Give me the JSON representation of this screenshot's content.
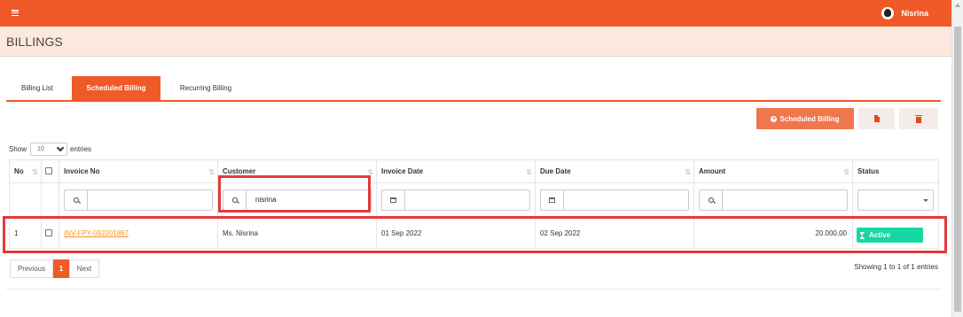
{
  "header": {
    "user_name": "Nisrina"
  },
  "page": {
    "title": "BILLINGS"
  },
  "tabs": [
    {
      "label": "Billing List",
      "active": false
    },
    {
      "label": "Scheduled Billing",
      "active": true
    },
    {
      "label": "Recurring Billing",
      "active": false
    }
  ],
  "toolbar": {
    "add_label": "Scheduled Billing",
    "pdf_icon": "file-pdf-icon",
    "delete_icon": "trash-icon"
  },
  "entries": {
    "show_label": "Show",
    "value": "10",
    "suffix": "entries"
  },
  "table": {
    "columns": [
      "No",
      "Invoice No",
      "Customer",
      "Invoice Date",
      "Due Date",
      "Amount",
      "Status"
    ],
    "filters": {
      "invoice_no": "",
      "customer": "nisrina",
      "invoice_date": "",
      "due_date": "",
      "amount": "",
      "status": ""
    },
    "rows": [
      {
        "no": "1",
        "invoice_no": "INV-FPY-092201867",
        "customer": "Ms. Nisrina",
        "invoice_date": "01 Sep 2022",
        "due_date": "02 Sep 2022",
        "amount": "20.000,00",
        "status": "Active"
      }
    ]
  },
  "pagination": {
    "previous": "Previous",
    "current": "1",
    "next": "Next",
    "info": "Showing 1 to 1 of 1 entries"
  },
  "colors": {
    "brand": "#f05a28",
    "status_active": "#14d8a2",
    "highlight": "#e03a3a",
    "link": "#f7941d"
  }
}
